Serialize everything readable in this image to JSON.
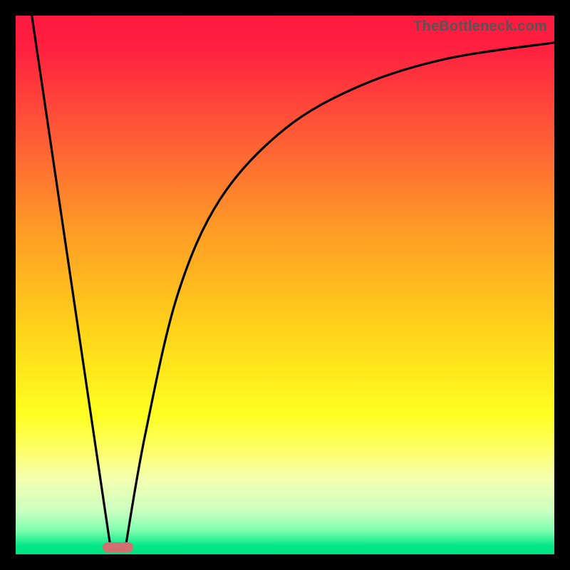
{
  "watermark": "TheBottleneck.com",
  "chart_data": {
    "type": "line",
    "title": "",
    "xlabel": "",
    "ylabel": "",
    "xlim": [
      0,
      100
    ],
    "ylim": [
      0,
      100
    ],
    "grid": false,
    "legend": false,
    "gradient_stops": [
      {
        "pos": 0.0,
        "color": "#ff1940"
      },
      {
        "pos": 0.06,
        "color": "#ff2040"
      },
      {
        "pos": 0.22,
        "color": "#ff5a36"
      },
      {
        "pos": 0.4,
        "color": "#ff9c26"
      },
      {
        "pos": 0.58,
        "color": "#ffd21a"
      },
      {
        "pos": 0.74,
        "color": "#feff20"
      },
      {
        "pos": 0.8,
        "color": "#feff60"
      },
      {
        "pos": 0.86,
        "color": "#f4ffb0"
      },
      {
        "pos": 0.92,
        "color": "#caffc0"
      },
      {
        "pos": 0.955,
        "color": "#80ffb0"
      },
      {
        "pos": 0.985,
        "color": "#00e887"
      },
      {
        "pos": 1.0,
        "color": "#00e07f"
      }
    ],
    "series": [
      {
        "name": "left-line",
        "segment": "straight",
        "points": [
          {
            "x": 3,
            "y": 100
          },
          {
            "x": 17.5,
            "y": 2
          }
        ]
      },
      {
        "name": "right-curve",
        "segment": "curve",
        "points": [
          {
            "x": 20.5,
            "y": 2
          },
          {
            "x": 24,
            "y": 22
          },
          {
            "x": 30,
            "y": 48
          },
          {
            "x": 38,
            "y": 66
          },
          {
            "x": 50,
            "y": 79
          },
          {
            "x": 64,
            "y": 87
          },
          {
            "x": 80,
            "y": 92
          },
          {
            "x": 100,
            "y": 95
          }
        ]
      }
    ],
    "marker": {
      "name": "bottleneck-zone",
      "x_start": 16.2,
      "x_end": 21.8,
      "y": 1.3,
      "color": "#d07070"
    }
  }
}
